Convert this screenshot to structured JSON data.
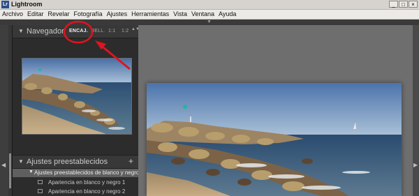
{
  "window": {
    "app_icon": "Lr",
    "title": "Lightroom",
    "minimize": "_",
    "maximize": "□",
    "close": "×"
  },
  "menu": [
    "Archivo",
    "Editar",
    "Revelar",
    "Fotografía",
    "Ajustes",
    "Herramientas",
    "Vista",
    "Ventana",
    "Ayuda"
  ],
  "navigator": {
    "title": "Navegador",
    "zoom_options": [
      "ENCAJ.",
      "RELL.",
      "1:1",
      "1:2"
    ],
    "active_zoom": "ENCAJ."
  },
  "presets": {
    "title": "Ajustes preestablecidos",
    "add": "+",
    "folder": "Ajustes preestablecidos de blanco y negro",
    "items": [
      "Apariencia en blanco y negro 1",
      "Apariencia en blanco y negro 2"
    ]
  },
  "icons": {
    "collapse": "▼",
    "panel_left": "◀",
    "panel_right": "▶",
    "panel_top": "▼",
    "zoom_stepper": "▲▼"
  },
  "colors": {
    "annotation": "#e0141e",
    "panel_bg": "#2c2c2c",
    "canvas_bg": "#6e6e6e",
    "folder_highlight": "#5f5f5f"
  }
}
